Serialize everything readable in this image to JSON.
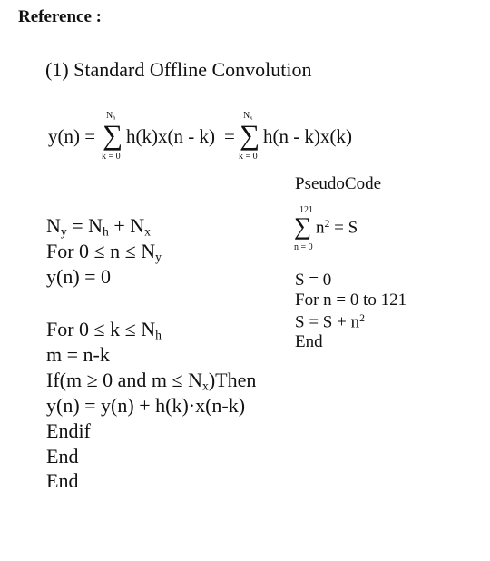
{
  "heading": "Reference :",
  "section_title": "(1) Standard Offline Convolution",
  "equation": {
    "lhs": "y(n) =",
    "sum1": {
      "upper": "N",
      "upper_sub": "h",
      "lower": "k = 0",
      "body": "h(k)x(n - k)"
    },
    "eq2": "=",
    "sum2": {
      "upper": "N",
      "upper_sub": "x",
      "lower": "k = 0",
      "body": "h(n - k)x(k)"
    },
    "sigma": "∑"
  },
  "algorithm": {
    "line1": {
      "a": "N",
      "a_sub": "y",
      "b": " = N",
      "b_sub": "h",
      "c": " + N",
      "c_sub": "x"
    },
    "line2": {
      "text": "For 0 ≤ n ≤ N",
      "sub": "y"
    },
    "line3": "y(n) = 0",
    "line4": {
      "text": "For 0 ≤ k ≤ N",
      "sub": "h"
    },
    "line5": "m = n-k",
    "line6": {
      "a": "If(m ≥ 0 and m ≤ N",
      "sub": "x",
      "b": ")Then"
    },
    "line7": "y(n) = y(n) + h(k)·x(n-k)",
    "line8": "Endif",
    "line9": "End",
    "line10": "End"
  },
  "pseudocode": {
    "title": "PseudoCode",
    "sum": {
      "upper": "121",
      "lower": "n = 0",
      "body": "n",
      "body_sup": "2",
      "rhs": " = S"
    },
    "lines": [
      "S = 0",
      "For n = 0 to 121"
    ],
    "line3": {
      "a": "S = S + n",
      "sup": "2"
    },
    "line4": "End"
  }
}
